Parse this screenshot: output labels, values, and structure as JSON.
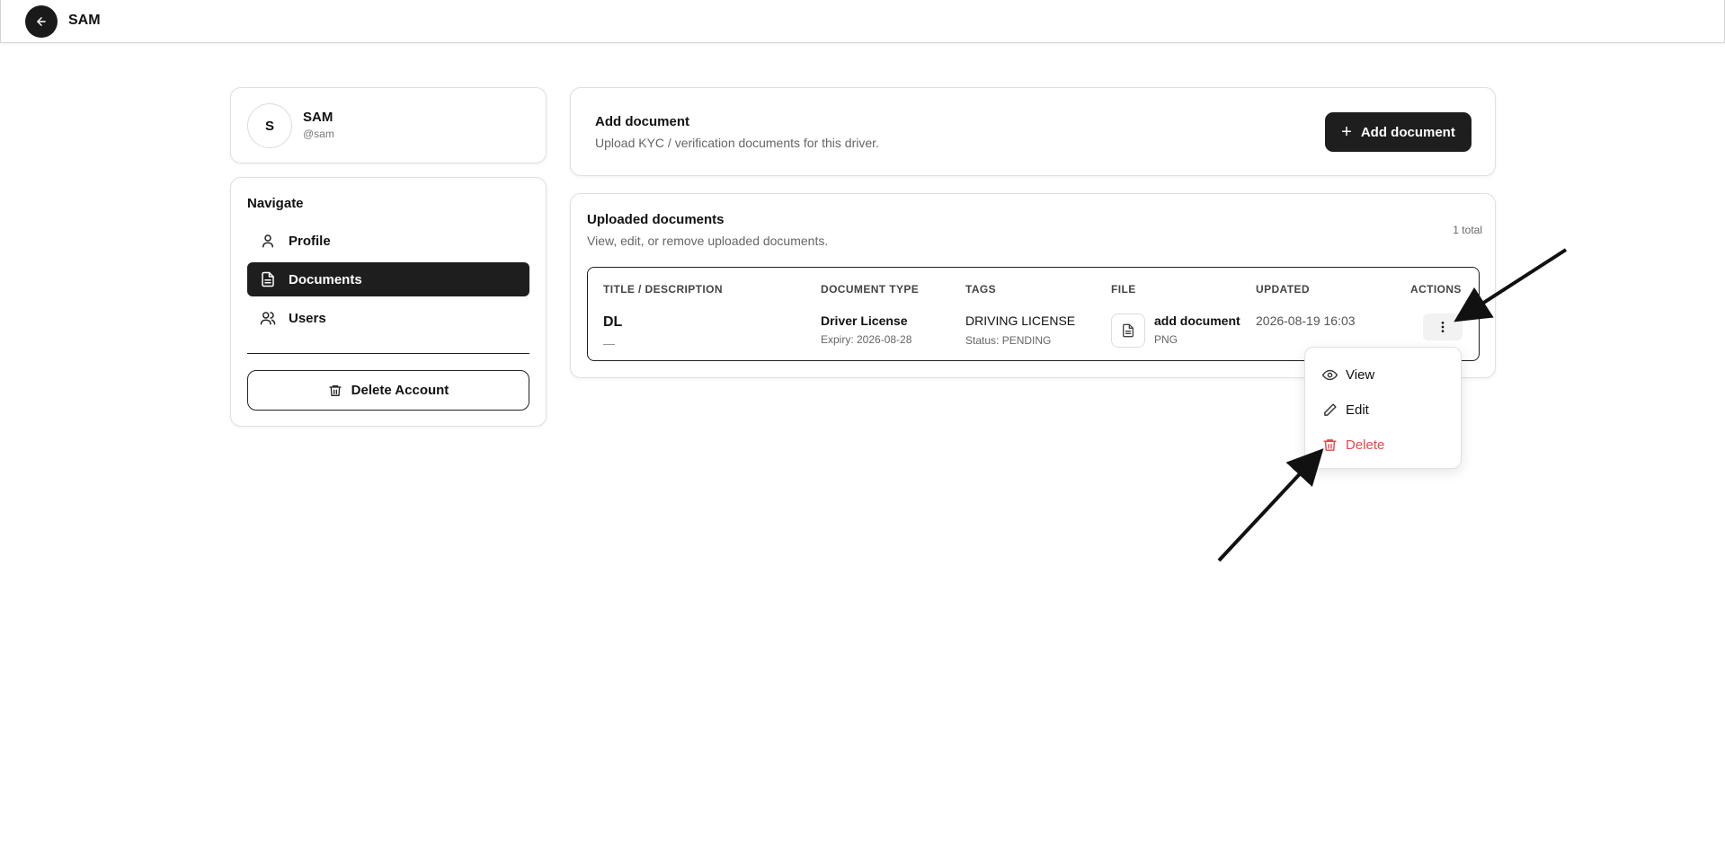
{
  "topbar": {
    "title": "SAM"
  },
  "profile": {
    "initial": "S",
    "name": "SAM",
    "handle": "@sam"
  },
  "nav": {
    "heading": "Navigate",
    "items": [
      {
        "label": "Profile",
        "icon": "user-icon",
        "active": false
      },
      {
        "label": "Documents",
        "icon": "document-icon",
        "active": true
      },
      {
        "label": "Users",
        "icon": "users-icon",
        "active": false
      }
    ],
    "delete_label": "Delete Account"
  },
  "add_document": {
    "title": "Add document",
    "subtitle": "Upload KYC / verification documents for this driver.",
    "button_label": "Add document"
  },
  "uploaded": {
    "title": "Uploaded documents",
    "subtitle": "View, edit, or remove uploaded documents.",
    "count": "1 total",
    "columns": [
      "TITLE / DESCRIPTION",
      "DOCUMENT TYPE",
      "TAGS",
      "FILE",
      "UPDATED",
      "ACTIONS"
    ],
    "rows": [
      {
        "title": "DL",
        "description": "—",
        "doc_type": "Driver License",
        "expiry": "Expiry: 2026-08-28",
        "tag": "DRIVING LICENSE",
        "status": "Status: PENDING",
        "file_name": "add document",
        "file_type": "PNG",
        "updated": "2026-08-19 16:03"
      }
    ]
  },
  "actions_menu": {
    "items": [
      {
        "label": "View",
        "icon": "eye-icon"
      },
      {
        "label": "Edit",
        "icon": "pencil-icon"
      },
      {
        "label": "Delete",
        "icon": "trash-icon",
        "color": "#e5484d"
      }
    ]
  },
  "colors": {
    "primary": "#1e1e1e",
    "danger": "#e5484d",
    "border": "#e0e0e0"
  }
}
